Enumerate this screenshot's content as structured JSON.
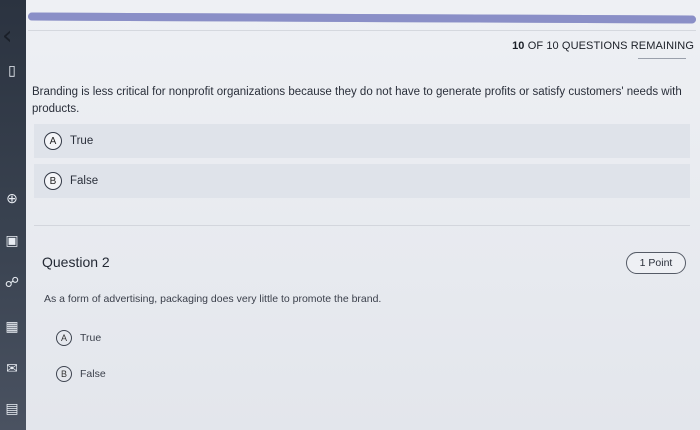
{
  "progress": {
    "fraction": 1.0
  },
  "header": {
    "remaining_count": "10",
    "remaining_text": "OF 10 QUESTIONS REMAINING"
  },
  "question1": {
    "text": "Branding is less critical for nonprofit organizations because they do not have to generate profits or satisfy customers' needs with products.",
    "options": [
      {
        "letter": "A",
        "label": "True"
      },
      {
        "letter": "B",
        "label": "False"
      }
    ]
  },
  "question2": {
    "title": "Question 2",
    "points": "1 Point",
    "text": "As a form of advertising, packaging does very little to promote the brand.",
    "options": [
      {
        "letter": "A",
        "label": "True"
      },
      {
        "letter": "B",
        "label": "False"
      }
    ]
  },
  "colors": {
    "accent": "#8a8fc7",
    "rail": "#2b3340"
  },
  "icons": [
    "back-chevron-icon",
    "globe-icon",
    "window-icon",
    "people-icon",
    "calendar-icon",
    "mail-icon",
    "document-icon"
  ]
}
